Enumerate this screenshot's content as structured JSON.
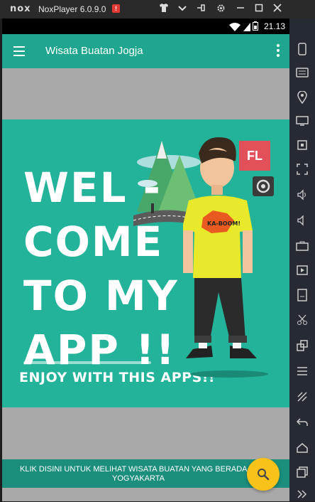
{
  "window": {
    "logo_text": "nox",
    "title": "NoxPlayer 6.0.9.0",
    "warn_badge": "!",
    "controls": [
      "shirt-icon",
      "chevron-down-icon",
      "pin-icon",
      "gear-icon",
      "minimize-icon",
      "maximize-icon",
      "close-icon"
    ]
  },
  "status": {
    "time": "21.13"
  },
  "appbar": {
    "title": "Wisata Buatan Jogja"
  },
  "banner": {
    "line1": "WEL -",
    "line2": "COME",
    "line3": "TO MY",
    "line4": "APP !!",
    "tagline": "ENJOY WITH THIS APPS!!",
    "fl_badge": "FL",
    "shirt_text": "KA-BOOM!"
  },
  "footer": {
    "text": "KLIK DISINI UNTUK MELIHAT WISATA BUATAN YANG BERADA DI YOGYAKARTA"
  },
  "sidebar": {
    "icons": [
      "phone-icon",
      "keyboard-icon",
      "location-icon",
      "monitor-icon",
      "screenshot-icon",
      "fullscreen-icon",
      "volume-up-icon",
      "volume-down-icon",
      "toolbox-icon",
      "screen-record-icon",
      "apk-icon",
      "scissors-icon",
      "multi-window-icon",
      "menu-icon",
      "shake-icon",
      "back-icon",
      "home-icon",
      "recent-apps-icon",
      "expand-icon"
    ]
  },
  "colors": {
    "teal": "#1fa590",
    "banner": "#23b39a",
    "footer": "#1b8e7c",
    "fab": "#f8c21a",
    "fl_badge": "#e2505a"
  }
}
